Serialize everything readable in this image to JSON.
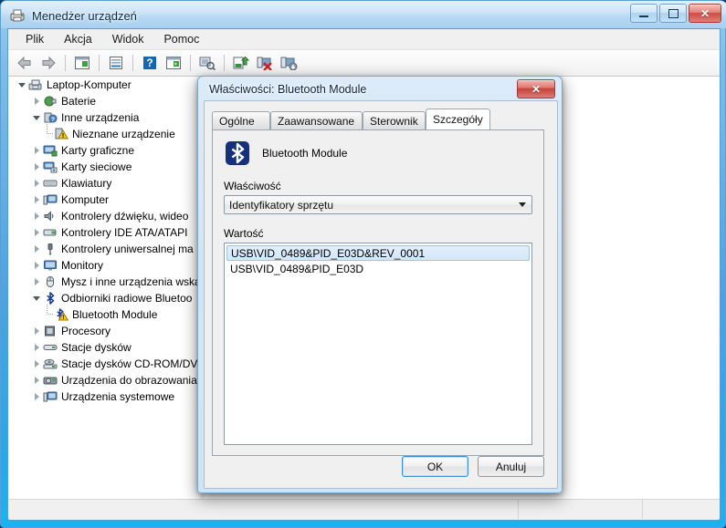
{
  "window": {
    "title": "Menedżer urządzeń",
    "icon": "device-manager-icon",
    "minimize_label": "—",
    "maximize_label": "□",
    "close_label": "✕"
  },
  "menubar": {
    "items": [
      {
        "label": "Plik",
        "name": "menu-plik"
      },
      {
        "label": "Akcja",
        "name": "menu-akcja"
      },
      {
        "label": "Widok",
        "name": "menu-widok"
      },
      {
        "label": "Pomoc",
        "name": "menu-pomoc"
      }
    ]
  },
  "toolbar": {
    "buttons": [
      {
        "icon": "back-arrow-icon"
      },
      {
        "icon": "forward-arrow-icon"
      },
      {
        "icon": "show-hide-tree-icon"
      },
      {
        "icon": "properties-icon"
      },
      {
        "icon": "help-icon"
      },
      {
        "icon": "console-tree-icon"
      },
      {
        "icon": "scan-hardware-changes-icon"
      },
      {
        "icon": "update-driver-icon"
      },
      {
        "icon": "disable-device-icon"
      },
      {
        "icon": "enable-device-icon"
      }
    ]
  },
  "tree": {
    "root": {
      "label": "Laptop-Komputer",
      "icon": "computer-icon",
      "state": "expanded",
      "level": 0
    },
    "nodes": [
      {
        "label": "Baterie",
        "icon": "battery-icon",
        "state": "collapsed",
        "level": 1
      },
      {
        "label": "Inne urządzenia",
        "icon": "other-devices-icon",
        "state": "expanded",
        "level": 1
      },
      {
        "label": "Nieznane urządzenie",
        "icon": "unknown-device-warning-icon",
        "state": "leaf",
        "level": 2
      },
      {
        "label": "Karty graficzne",
        "icon": "display-adapter-icon",
        "state": "collapsed",
        "level": 1
      },
      {
        "label": "Karty sieciowe",
        "icon": "network-adapter-icon",
        "state": "collapsed",
        "level": 1
      },
      {
        "label": "Klawiatury",
        "icon": "keyboard-icon",
        "state": "collapsed",
        "level": 1
      },
      {
        "label": "Komputer",
        "icon": "computer-icon",
        "state": "collapsed",
        "level": 1
      },
      {
        "label": "Kontrolery dźwięku, wideo",
        "icon": "sound-controller-icon",
        "state": "collapsed",
        "level": 1
      },
      {
        "label": "Kontrolery IDE ATA/ATAPI",
        "icon": "ide-controller-icon",
        "state": "collapsed",
        "level": 1
      },
      {
        "label": "Kontrolery uniwersalnej ma",
        "icon": "usb-controller-icon",
        "state": "collapsed",
        "level": 1
      },
      {
        "label": "Monitory",
        "icon": "monitor-icon",
        "state": "collapsed",
        "level": 1
      },
      {
        "label": "Mysz i inne urządzenia wska",
        "icon": "mouse-icon",
        "state": "collapsed",
        "level": 1
      },
      {
        "label": "Odbiorniki radiowe Bluetoo",
        "icon": "bluetooth-icon",
        "state": "expanded",
        "level": 1
      },
      {
        "label": "Bluetooth Module",
        "icon": "bluetooth-warning-icon",
        "state": "leaf",
        "level": 2
      },
      {
        "label": "Procesory",
        "icon": "processor-icon",
        "state": "collapsed",
        "level": 1
      },
      {
        "label": "Stacje dysków",
        "icon": "disk-drive-icon",
        "state": "collapsed",
        "level": 1
      },
      {
        "label": "Stacje dysków CD-ROM/DV",
        "icon": "cdrom-drive-icon",
        "state": "collapsed",
        "level": 1
      },
      {
        "label": "Urządzenia do obrazowania",
        "icon": "imaging-device-icon",
        "state": "collapsed",
        "level": 1
      },
      {
        "label": "Urządzenia systemowe",
        "icon": "system-device-icon",
        "state": "collapsed",
        "level": 1
      }
    ]
  },
  "dialog": {
    "title": "Właściwości: Bluetooth Module",
    "close_label": "✕",
    "tabs": [
      {
        "label": "Ogólne",
        "name": "tab-ogolne",
        "active": false
      },
      {
        "label": "Zaawansowane",
        "name": "tab-zaawansowane",
        "active": false
      },
      {
        "label": "Sterownik",
        "name": "tab-sterownik",
        "active": false
      },
      {
        "label": "Szczegóły",
        "name": "tab-szczegoly",
        "active": true
      }
    ],
    "device_name": "Bluetooth Module",
    "device_icon": "bluetooth-icon",
    "property_label": "Właściwość",
    "property_selected": "Identyfikatory sprzętu",
    "value_label": "Wartość",
    "values": [
      {
        "text": "USB\\VID_0489&PID_E03D&REV_0001",
        "selected": true
      },
      {
        "text": "USB\\VID_0489&PID_E03D",
        "selected": false
      }
    ],
    "ok_label": "OK",
    "cancel_label": "Anuluj"
  },
  "colors": {
    "accent_blue": "#1a9fe0",
    "bluetooth_blue": "#1c3f94",
    "selection_blue": "#d3e7f8",
    "close_red": "#c7423a",
    "warning_yellow": "#f5c518"
  }
}
